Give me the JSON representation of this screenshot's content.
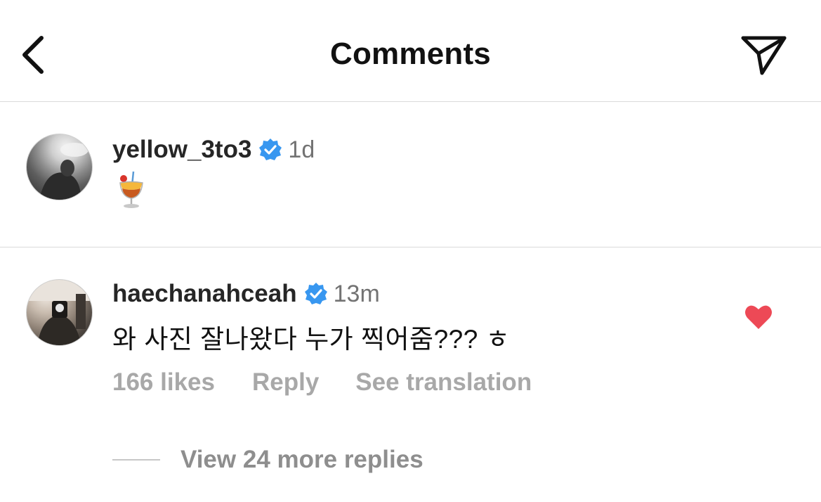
{
  "header": {
    "title": "Comments",
    "back_icon": "chevron-left-icon",
    "share_icon": "paper-plane-icon"
  },
  "caption": {
    "username": "yellow_3to3",
    "verified": true,
    "time": "1d",
    "emoji": "tropical-drink-icon"
  },
  "comment": {
    "username": "haechanahceah",
    "verified": true,
    "time": "13m",
    "text": "와 사진 잘나왔다 누가 찍어줌??? ㅎ",
    "likes_label": "166 likes",
    "reply_label": "Reply",
    "translate_label": "See translation",
    "liked": true,
    "view_more_label": "View 24 more replies"
  },
  "colors": {
    "verified_blue": "#3897f0",
    "heart_red": "#ed4956",
    "secondary_text": "#a8a8a8"
  }
}
